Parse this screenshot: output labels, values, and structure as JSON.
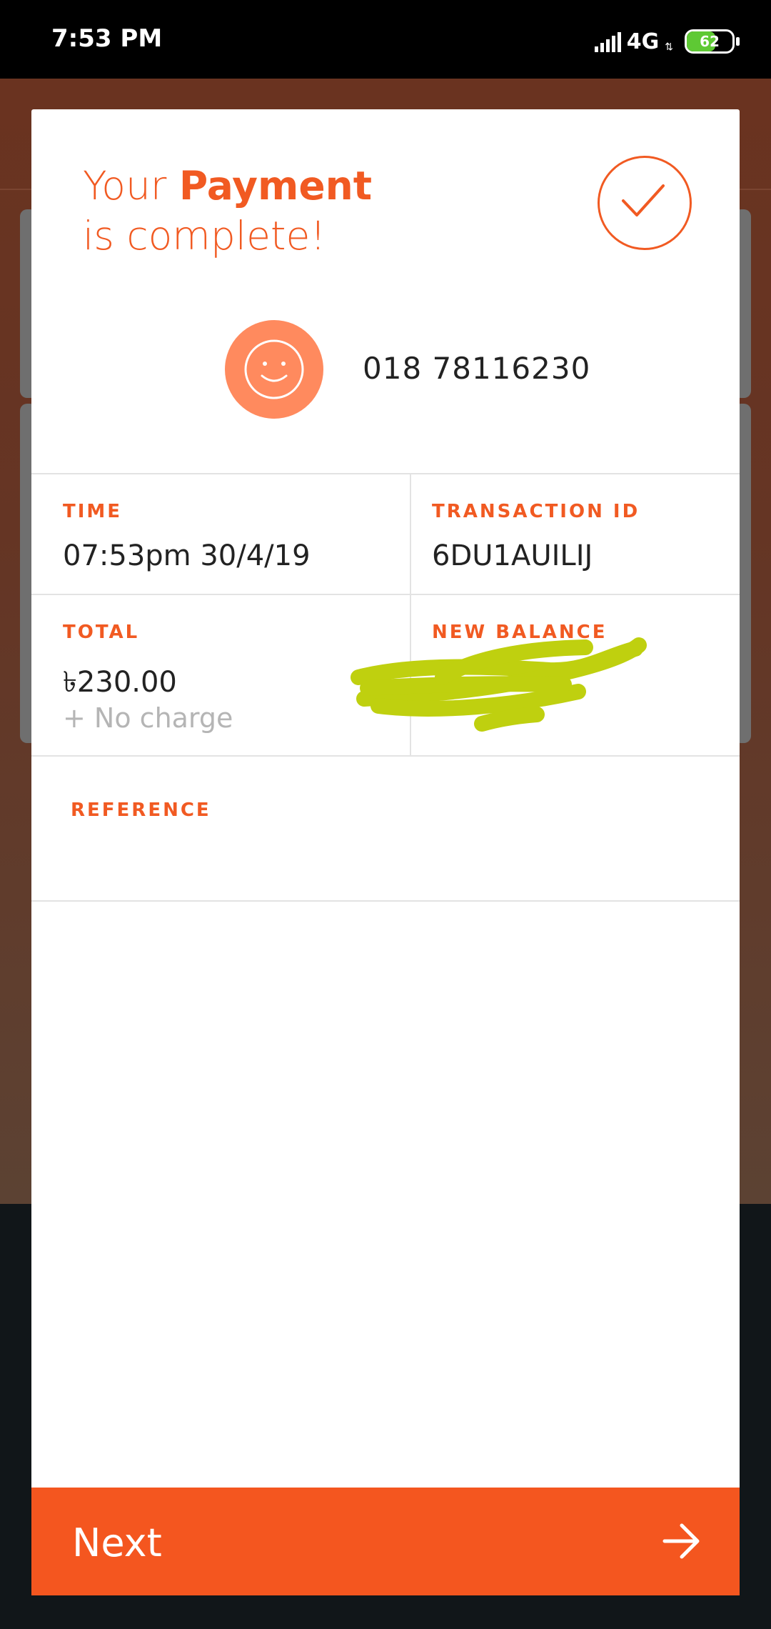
{
  "status_bar": {
    "time": "7:53 PM",
    "network": "4G",
    "battery_level": "62",
    "battery_fraction": 0.62
  },
  "dialog": {
    "title_prefix": "Your ",
    "title_bold": "Payment",
    "title_suffix": "is complete!",
    "recipient_number": "018 78116230",
    "time": {
      "label": "TIME",
      "value": "07:53pm 30/4/19"
    },
    "transaction_id": {
      "label": "TRANSACTION ID",
      "value": "6DU1AUILIJ"
    },
    "total": {
      "label": "TOTAL",
      "value": "৳230.00",
      "charge": "+ No charge"
    },
    "new_balance": {
      "label": "NEW BALANCE"
    },
    "reference": {
      "label": "REFERENCE",
      "value": ""
    },
    "next_button": {
      "label": "Next"
    }
  },
  "colors": {
    "accent": "#f15a22",
    "button": "#f4561f",
    "avatar": "#ff8a5e",
    "scribble": "#bfd00f"
  },
  "icons": [
    "check-icon",
    "smiley-icon",
    "arrow-right-icon",
    "signal-icon",
    "battery-icon"
  ]
}
